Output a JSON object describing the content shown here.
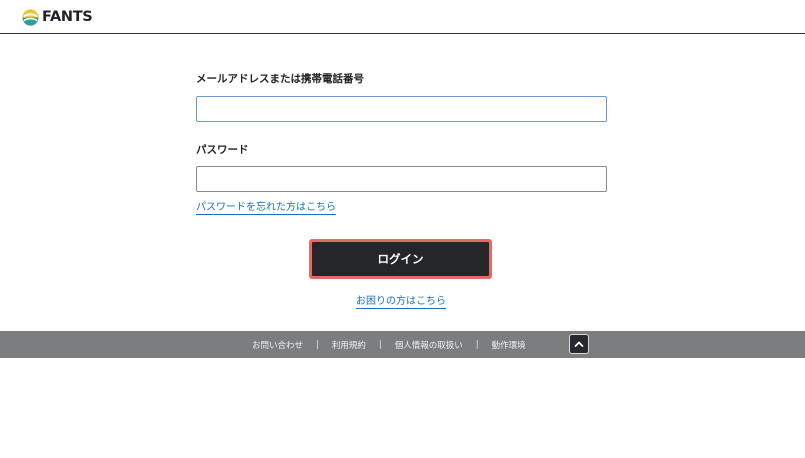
{
  "header": {
    "logo_text": "FANTS"
  },
  "form": {
    "id_label": "メールアドレスまたは携帯電話番号",
    "id_value": "",
    "password_label": "パスワード",
    "password_value": "",
    "forgot_password_link": "パスワードを忘れた方はこちら",
    "login_button": "ログイン",
    "help_link": "お困りの方はこちら"
  },
  "footer": {
    "links": [
      "お問い合わせ",
      "利用規約",
      "個人情報の取扱い",
      "動作環境"
    ],
    "separator": "|",
    "back_to_top_icon": "chevron-up-icon"
  },
  "colors": {
    "login_button_bg": "#25262a",
    "login_highlight": "#e56a64",
    "link": "#1a6fc0",
    "footer_bg": "#7b7d7f"
  }
}
